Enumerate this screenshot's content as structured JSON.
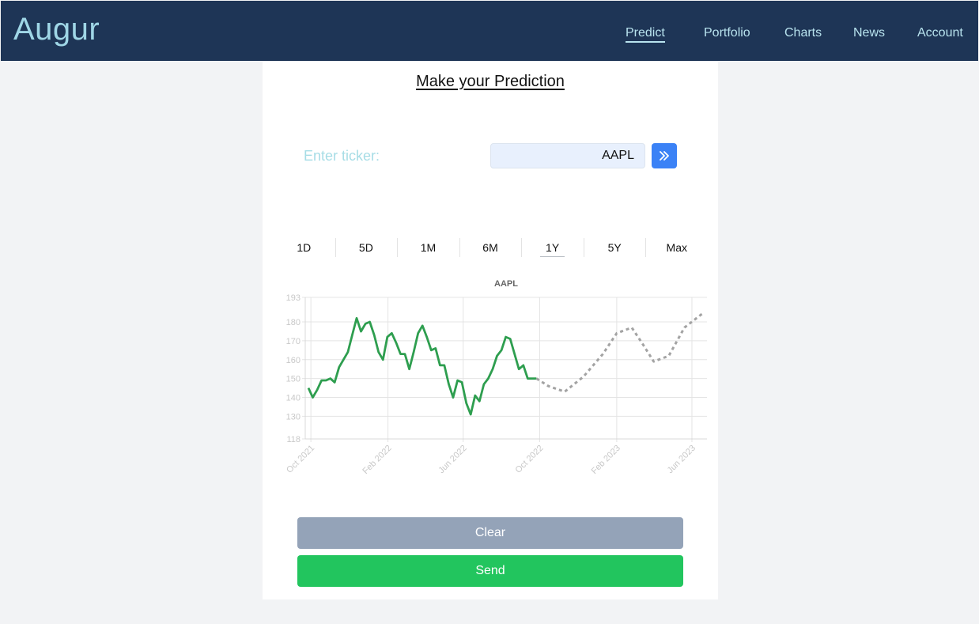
{
  "nav": {
    "brand": "Augur",
    "items": [
      {
        "label": "Predict",
        "active": true
      },
      {
        "label": "Portfolio",
        "active": false
      },
      {
        "label": "Charts",
        "active": false
      },
      {
        "label": "News",
        "active": false
      },
      {
        "label": "Account",
        "active": false
      }
    ]
  },
  "main": {
    "heading": "Make your Prediction",
    "ticker_label": "Enter ticker:",
    "ticker_value": "AAPL",
    "go_icon": "double-chevron-right-icon",
    "ranges": [
      "1D",
      "5D",
      "1M",
      "6M",
      "1Y",
      "5Y",
      "Max"
    ],
    "active_range": "1Y",
    "clear_label": "Clear",
    "send_label": "Send"
  },
  "colors": {
    "navbar": "#1e3556",
    "nav_text": "#b8e3ee",
    "accent_blue": "#3b82f6",
    "history_line": "#2e9e4f",
    "prediction_line": "#a3a3a3",
    "clear_button": "#94a3b8",
    "send_button": "#22c55e"
  },
  "chart_data": {
    "type": "line",
    "title": "AAPL",
    "ylim": [
      118,
      193
    ],
    "yticks": [
      118,
      130,
      140,
      150,
      160,
      170,
      180,
      193
    ],
    "xlim": [
      "2021-09-22",
      "2023-06-25"
    ],
    "xticks": [
      {
        "date": "2021-10-01",
        "label": "Oct 2021"
      },
      {
        "date": "2022-02-01",
        "label": "Feb 2022"
      },
      {
        "date": "2022-06-01",
        "label": "Jun 2022"
      },
      {
        "date": "2022-10-01",
        "label": "Oct 2022"
      },
      {
        "date": "2023-02-01",
        "label": "Feb 2023"
      },
      {
        "date": "2023-06-01",
        "label": "Jun 2023"
      }
    ],
    "grid": true,
    "series": [
      {
        "style": "solid",
        "points": [
          [
            "2021-09-27",
            145
          ],
          [
            "2021-10-04",
            140
          ],
          [
            "2021-10-11",
            144
          ],
          [
            "2021-10-18",
            149
          ],
          [
            "2021-10-25",
            149
          ],
          [
            "2021-11-01",
            150
          ],
          [
            "2021-11-08",
            148
          ],
          [
            "2021-11-15",
            156
          ],
          [
            "2021-11-22",
            160
          ],
          [
            "2021-11-29",
            164
          ],
          [
            "2021-12-06",
            173
          ],
          [
            "2021-12-13",
            182
          ],
          [
            "2021-12-20",
            175
          ],
          [
            "2021-12-27",
            179
          ],
          [
            "2022-01-03",
            180
          ],
          [
            "2022-01-10",
            173
          ],
          [
            "2022-01-17",
            164
          ],
          [
            "2022-01-24",
            160
          ],
          [
            "2022-01-31",
            172
          ],
          [
            "2022-02-07",
            174
          ],
          [
            "2022-02-14",
            169
          ],
          [
            "2022-02-21",
            163
          ],
          [
            "2022-02-28",
            163
          ],
          [
            "2022-03-07",
            155
          ],
          [
            "2022-03-14",
            164
          ],
          [
            "2022-03-21",
            174
          ],
          [
            "2022-03-28",
            178
          ],
          [
            "2022-04-04",
            172
          ],
          [
            "2022-04-11",
            165
          ],
          [
            "2022-04-18",
            166
          ],
          [
            "2022-04-25",
            157
          ],
          [
            "2022-05-02",
            157
          ],
          [
            "2022-05-09",
            147
          ],
          [
            "2022-05-16",
            140
          ],
          [
            "2022-05-23",
            149
          ],
          [
            "2022-05-30",
            148
          ],
          [
            "2022-06-06",
            137
          ],
          [
            "2022-06-13",
            131
          ],
          [
            "2022-06-20",
            141
          ],
          [
            "2022-06-27",
            138
          ],
          [
            "2022-07-04",
            147
          ],
          [
            "2022-07-11",
            150
          ],
          [
            "2022-07-18",
            155
          ],
          [
            "2022-07-25",
            162
          ],
          [
            "2022-08-01",
            165
          ],
          [
            "2022-08-08",
            172
          ],
          [
            "2022-08-15",
            171
          ],
          [
            "2022-08-22",
            163
          ],
          [
            "2022-08-29",
            155
          ],
          [
            "2022-09-05",
            157
          ],
          [
            "2022-09-12",
            150
          ],
          [
            "2022-09-19",
            150
          ],
          [
            "2022-09-26",
            150
          ]
        ]
      },
      {
        "style": "dashed",
        "points": [
          [
            "2022-09-26",
            150
          ],
          [
            "2022-10-15",
            146
          ],
          [
            "2022-11-10",
            143
          ],
          [
            "2022-12-10",
            151
          ],
          [
            "2023-01-10",
            163
          ],
          [
            "2023-02-01",
            174
          ],
          [
            "2023-02-25",
            177
          ],
          [
            "2023-03-15",
            168
          ],
          [
            "2023-04-01",
            159
          ],
          [
            "2023-04-25",
            162
          ],
          [
            "2023-05-20",
            177
          ],
          [
            "2023-06-20",
            185
          ]
        ]
      }
    ]
  }
}
